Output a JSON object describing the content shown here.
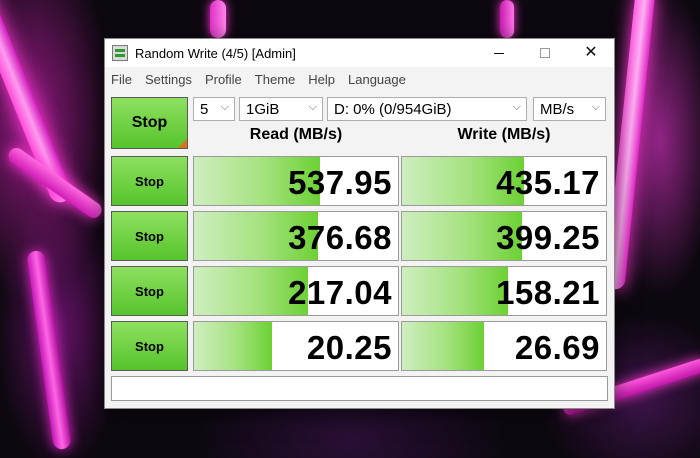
{
  "window": {
    "title": "Random Write (4/5) [Admin]",
    "minimize": "—",
    "maximize": "☐",
    "close": "✕"
  },
  "menu": [
    "File",
    "Settings",
    "Profile",
    "Theme",
    "Help",
    "Language"
  ],
  "controls": {
    "stop_all_label": "Stop",
    "count": "5",
    "size": "1GiB",
    "drive": "D: 0% (0/954GiB)",
    "unit": "MB/s"
  },
  "headers": {
    "read": "Read (MB/s)",
    "write": "Write (MB/s)"
  },
  "rows": [
    {
      "stop_label": "Stop",
      "read": "537.95",
      "write": "435.17",
      "read_fill": 0.62,
      "write_fill": 0.6
    },
    {
      "stop_label": "Stop",
      "read": "376.68",
      "write": "399.25",
      "read_fill": 0.61,
      "write_fill": 0.59
    },
    {
      "stop_label": "Stop",
      "read": "217.04",
      "write": "158.21",
      "read_fill": 0.56,
      "write_fill": 0.52
    },
    {
      "stop_label": "Stop",
      "read": "20.25",
      "write": "26.69",
      "read_fill": 0.38,
      "write_fill": 0.4
    }
  ],
  "comment": ""
}
